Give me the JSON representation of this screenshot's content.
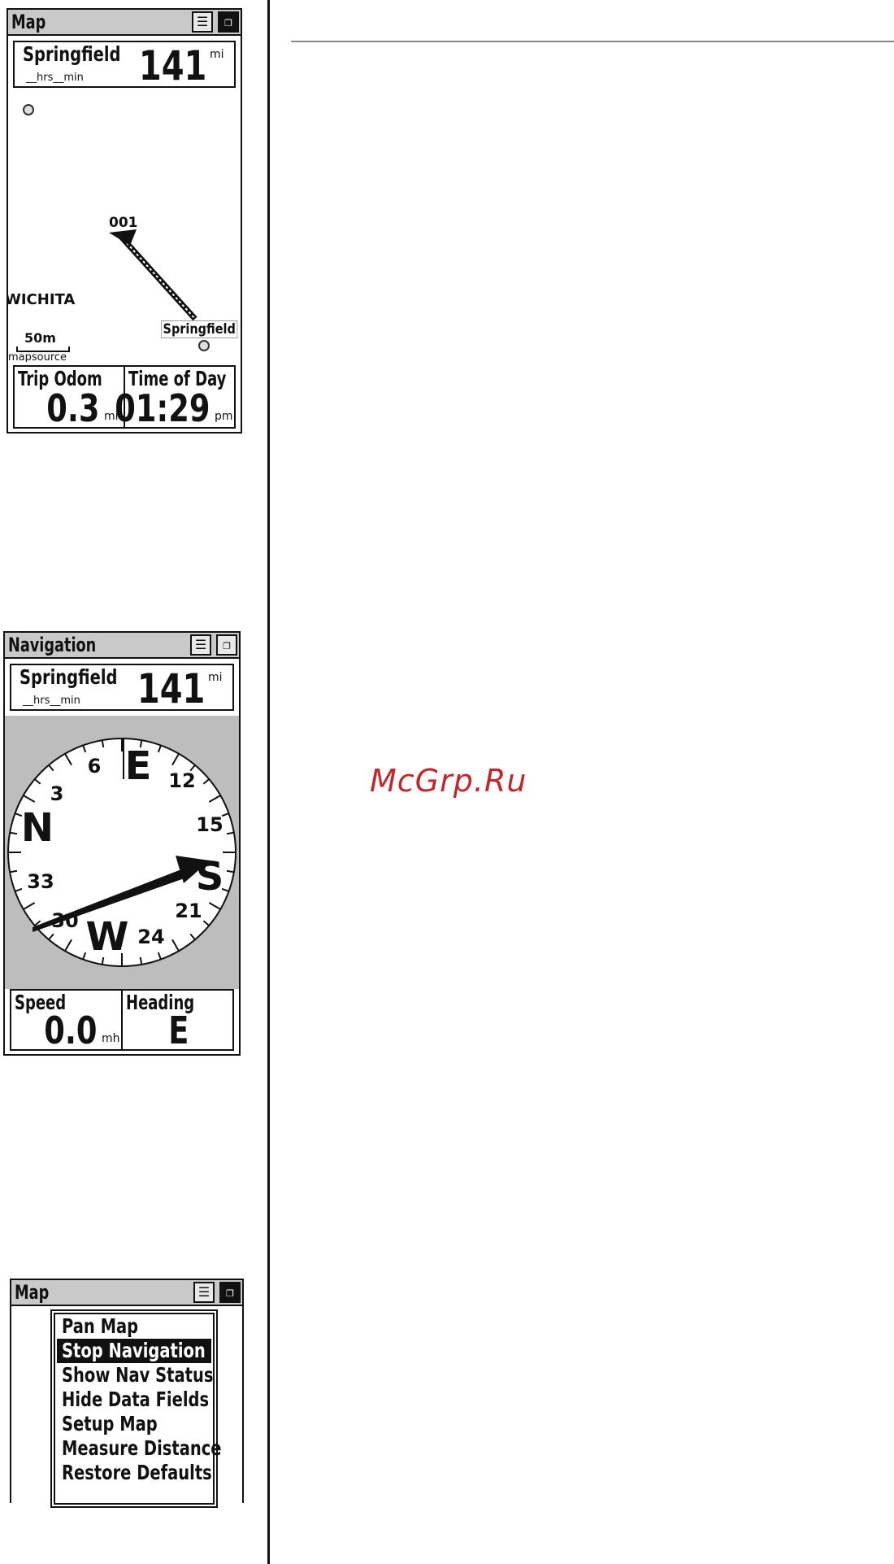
{
  "watermark": "McGrp.Ru",
  "map_screen": {
    "title": "Map",
    "destination": "Springfield",
    "eta": "__hrs__min",
    "distance": "141",
    "distance_unit": "mi",
    "track_label": "001",
    "city_label": "WICHITA",
    "waypoint_label": "Springfield",
    "scale": "50m",
    "map_source": "mapsource",
    "fields": [
      {
        "label": "Trip Odom",
        "value": "0.3",
        "unit": "mi"
      },
      {
        "label": "Time of Day",
        "value": "01:29",
        "unit": "pm"
      }
    ]
  },
  "nav_screen": {
    "title": "Navigation",
    "destination": "Springfield",
    "eta": "__hrs__min",
    "distance": "141",
    "distance_unit": "mi",
    "compass": {
      "cardinals": [
        "E",
        "N",
        "S",
        "W"
      ],
      "ticks": [
        "6",
        "12",
        "3",
        "15",
        "33",
        "21",
        "30",
        "24"
      ]
    },
    "fields": [
      {
        "label": "Speed",
        "value": "0.0",
        "unit": "mh"
      },
      {
        "label": "Heading",
        "value": "E",
        "unit": ""
      }
    ]
  },
  "menu_screen": {
    "title": "Map",
    "items": [
      {
        "label": "Pan Map",
        "selected": false
      },
      {
        "label": "Stop Navigation",
        "selected": true
      },
      {
        "label": "Show Nav Status",
        "selected": false
      },
      {
        "label": "Hide Data Fields",
        "selected": false
      },
      {
        "label": "Setup Map",
        "selected": false
      },
      {
        "label": "Measure Distance",
        "selected": false
      },
      {
        "label": "Restore Defaults",
        "selected": false
      }
    ]
  },
  "icons": {
    "menu": "menu-list-icon",
    "pages": "page-switch-icon"
  }
}
